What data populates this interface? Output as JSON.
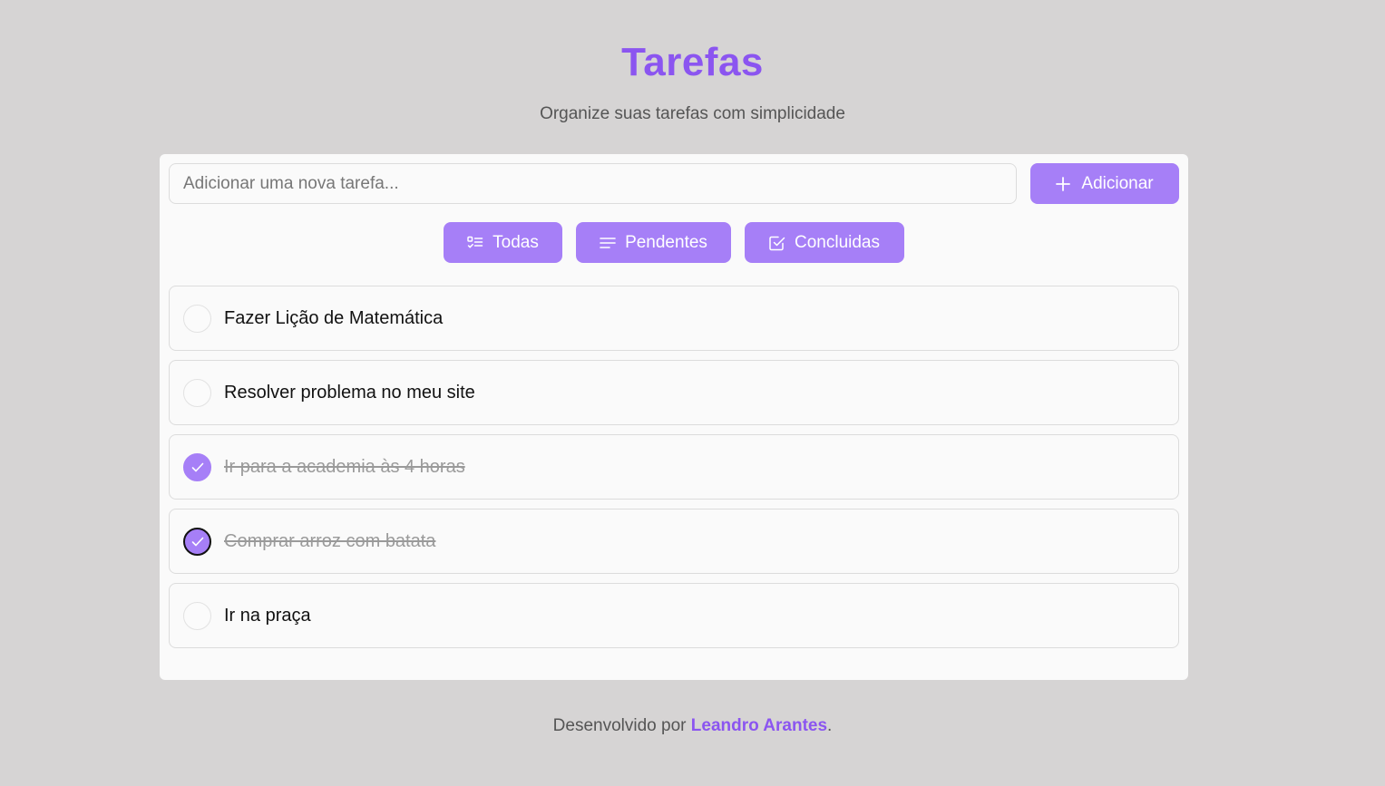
{
  "header": {
    "title": "Tarefas",
    "subtitle": "Organize suas tarefas com simplicidade"
  },
  "input": {
    "placeholder": "Adicionar uma nova tarefa...",
    "value": ""
  },
  "add_button": {
    "label": "Adicionar",
    "icon": "plus-icon"
  },
  "filters": [
    {
      "label": "Todas",
      "icon": "list-check-icon"
    },
    {
      "label": "Pendentes",
      "icon": "lines-icon"
    },
    {
      "label": "Concluidas",
      "icon": "square-check-icon"
    }
  ],
  "tasks": [
    {
      "text": "Fazer Lição de Matemática",
      "done": false
    },
    {
      "text": "Resolver problema no meu site",
      "done": false
    },
    {
      "text": "Ir para a academia às 4 horas",
      "done": true
    },
    {
      "text": "Comprar arroz com batata",
      "done": true
    },
    {
      "text": "Ir na praça",
      "done": false
    }
  ],
  "footer": {
    "prefix": "Desenvolvido por ",
    "author": "Leandro Arantes",
    "suffix": "."
  },
  "colors": {
    "accent": "#a67ff7",
    "title": "#8b55f0",
    "background": "#d6d4d4"
  }
}
